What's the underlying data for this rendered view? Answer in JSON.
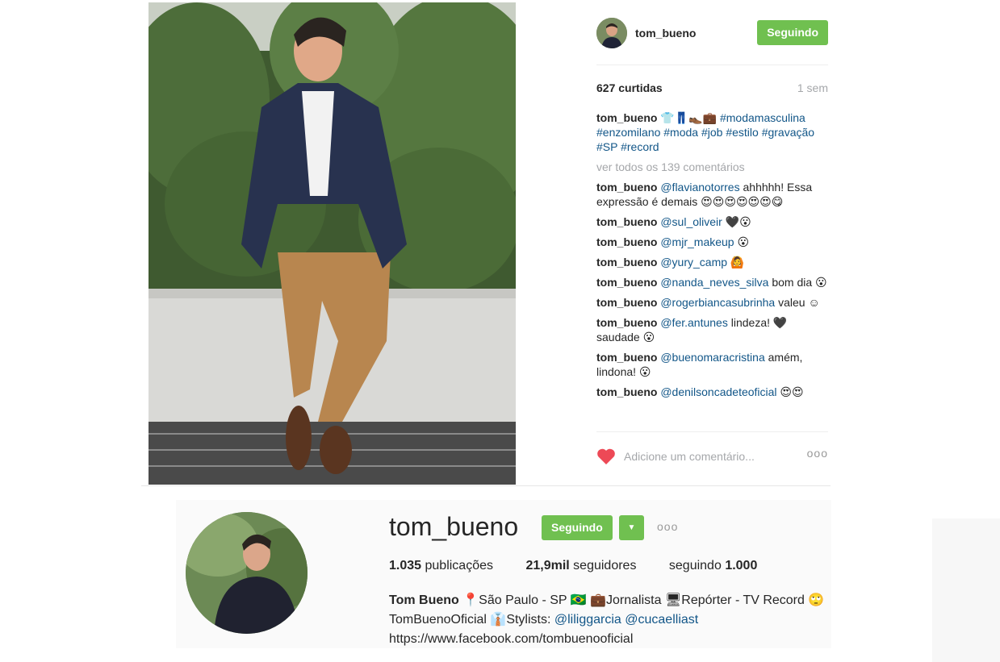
{
  "post": {
    "author": {
      "username": "tom_bueno",
      "follow_label": "Seguindo"
    },
    "likes": "627 curtidas",
    "time_ago": "1 sem",
    "caption": {
      "user": "tom_bueno",
      "emojis": "👕👖👞💼",
      "hashtags": "#modamasculina #enzomilano #moda #job #estilo #gravação #SP #record"
    },
    "view_all": "ver todos os 139 comentários",
    "comments": [
      {
        "user": "tom_bueno",
        "tag": "@flavianotorres",
        "text": " ahhhhh! Essa expressão é demais 😍😍😍😍😍😍😋"
      },
      {
        "user": "tom_bueno",
        "tag": "@sul_oliveir",
        "text": " 🖤😮"
      },
      {
        "user": "tom_bueno",
        "tag": "@mjr_makeup",
        "text": " 😮"
      },
      {
        "user": "tom_bueno",
        "tag": "@yury_camp",
        "text": " 🙆"
      },
      {
        "user": "tom_bueno",
        "tag": "@nanda_neves_silva",
        "text": " bom dia 😮"
      },
      {
        "user": "tom_bueno",
        "tag": "@rogerbiancasubrinha",
        "text": " valeu ☺"
      },
      {
        "user": "tom_bueno",
        "tag": "@fer.antunes",
        "text": " lindeza! 🖤 saudade 😮"
      },
      {
        "user": "tom_bueno",
        "tag": "@buenomaracristina",
        "text": " amém, lindona! 😮"
      },
      {
        "user": "tom_bueno",
        "tag": "@denilsoncadeteoficial",
        "text": " 😍😍"
      }
    ],
    "comment_placeholder": "Adicione um comentário...",
    "more_label": "ooo"
  },
  "profile": {
    "username": "tom_bueno",
    "follow_label": "Seguindo",
    "dropdown_label": "▼",
    "more_label": "ooo",
    "stats": {
      "posts_count": "1.035",
      "posts_label": "publicações",
      "followers_count": "21,9mil",
      "followers_label": "seguidores",
      "following_label": "seguindo",
      "following_count": "1.000"
    },
    "bio": {
      "name": "Tom Bueno",
      "line1": " 📍São Paulo - SP 🇧🇷 💼Jornalista 🖥Repórter - TV Record 🙄",
      "line2_prefix": "TomBuenoOficial 👔Stylists: ",
      "tag1": "@liliggarcia",
      "tag2": "@cucaelliast",
      "link": "https://www.facebook.com/tombuenooficial"
    }
  },
  "colors": {
    "accent_green": "#70c050",
    "link_blue": "#125688",
    "muted_gray": "#a5a7aa",
    "heart_red": "#ed4956"
  },
  "icons": {
    "heart": "heart-icon",
    "more": "more-options-icon",
    "dropdown": "chevron-down-icon"
  }
}
